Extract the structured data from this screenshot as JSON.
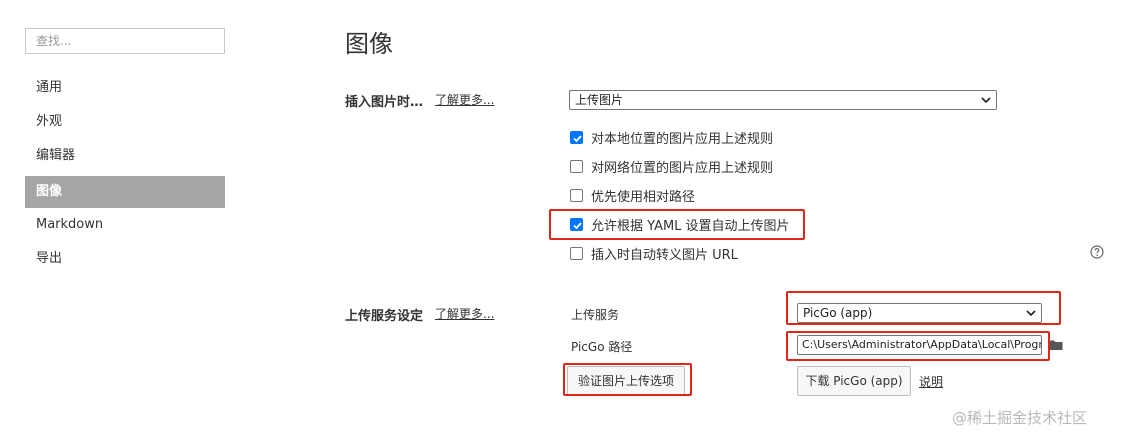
{
  "search": {
    "placeholder": "查找..."
  },
  "sidebar": {
    "items": [
      {
        "label": "通用"
      },
      {
        "label": "外观"
      },
      {
        "label": "编辑器"
      },
      {
        "label": "图像",
        "active": true
      },
      {
        "label": "Markdown"
      },
      {
        "label": "导出"
      }
    ]
  },
  "main": {
    "title": "图像",
    "insert": {
      "label": "插入图片时…",
      "learn_more": "了解更多...",
      "select_value": "上传图片",
      "checkboxes": [
        {
          "label": "对本地位置的图片应用上述规则",
          "checked": true
        },
        {
          "label": "对网络位置的图片应用上述规则",
          "checked": false
        },
        {
          "label": "优先使用相对路径",
          "checked": false
        },
        {
          "label": "允许根据 YAML 设置自动上传图片",
          "checked": true
        },
        {
          "label": "插入时自动转义图片 URL",
          "checked": false
        }
      ],
      "help_icon": "question-circle-icon"
    },
    "upload": {
      "label": "上传服务设定",
      "learn_more": "了解更多...",
      "service_label": "上传服务",
      "service_value": "PicGo (app)",
      "path_label": "PicGo 路径",
      "path_value": "C:\\Users\\Administrator\\AppData\\Local\\Programs\\PicGo\\PicGo.exe",
      "folder_icon": "folder-icon",
      "verify_button": "验证图片上传选项",
      "download_button": "下载 PicGo (app)",
      "doc_link": "说明"
    }
  },
  "watermark": "@稀土掘金技术社区",
  "colors": {
    "accent": "#0075ff",
    "highlight": "#e0251b",
    "active_nav": "#a6a6a6"
  }
}
